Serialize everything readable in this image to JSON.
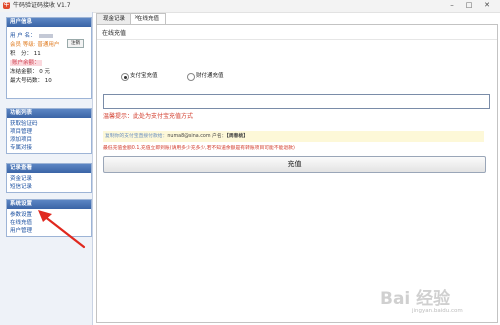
{
  "window": {
    "title": "牛码验证码接收 V1.7",
    "icon_glyph": "牛"
  },
  "user_info": {
    "header": "用户信息",
    "username_label": "用 户 名：",
    "exit_button": "注销",
    "member_label": "会员",
    "level_text": "等级: 普通用户",
    "points_label": "积　分：",
    "points_value": "11",
    "balance_label": "账户余额：",
    "frozen_label": "冻结金额：",
    "frozen_value": "0 元",
    "max_label": "最大号码数：",
    "max_value": "10"
  },
  "func_panel": {
    "header": "功能列表",
    "items": [
      "获取验证码",
      "项目管理",
      "添加项目",
      "专属对接"
    ]
  },
  "record_panel": {
    "header": "记录查看",
    "items": [
      "资金记录",
      "短信记录"
    ]
  },
  "settings_panel": {
    "header": "系统设置",
    "items": [
      "参数设置",
      "在线充值",
      "用户管理"
    ]
  },
  "tabs": [
    {
      "label": "现金记录",
      "active": false
    },
    {
      "label": "在线充值",
      "active": true
    }
  ],
  "tab_close": "✕",
  "recharge": {
    "title": "在线充值",
    "option_alipay": "支付宝充值",
    "option_tenpay": "财付通充值",
    "amount_value": "",
    "hint": "温馨提示：此处为支付宝充值方式",
    "note_prefix": "复制你的支付宝直接付款给：",
    "note_email": "numa8@sina.com",
    "note_name_label": " 户名：",
    "note_name_value": "【周春桃】",
    "rule": "最低充值金额0.1,充值立即到账(请用多少充多少,若不知道余额是有转账项目可能不能退款)",
    "submit_label": "充值"
  },
  "watermark": {
    "text": "Bai 经验",
    "url": "jingyan.baidu.com"
  },
  "colors": {
    "panel_header": "#3a64a6",
    "link": "#1a4fa0",
    "hint": "#d23a2a",
    "arrow": "#e0281e"
  }
}
